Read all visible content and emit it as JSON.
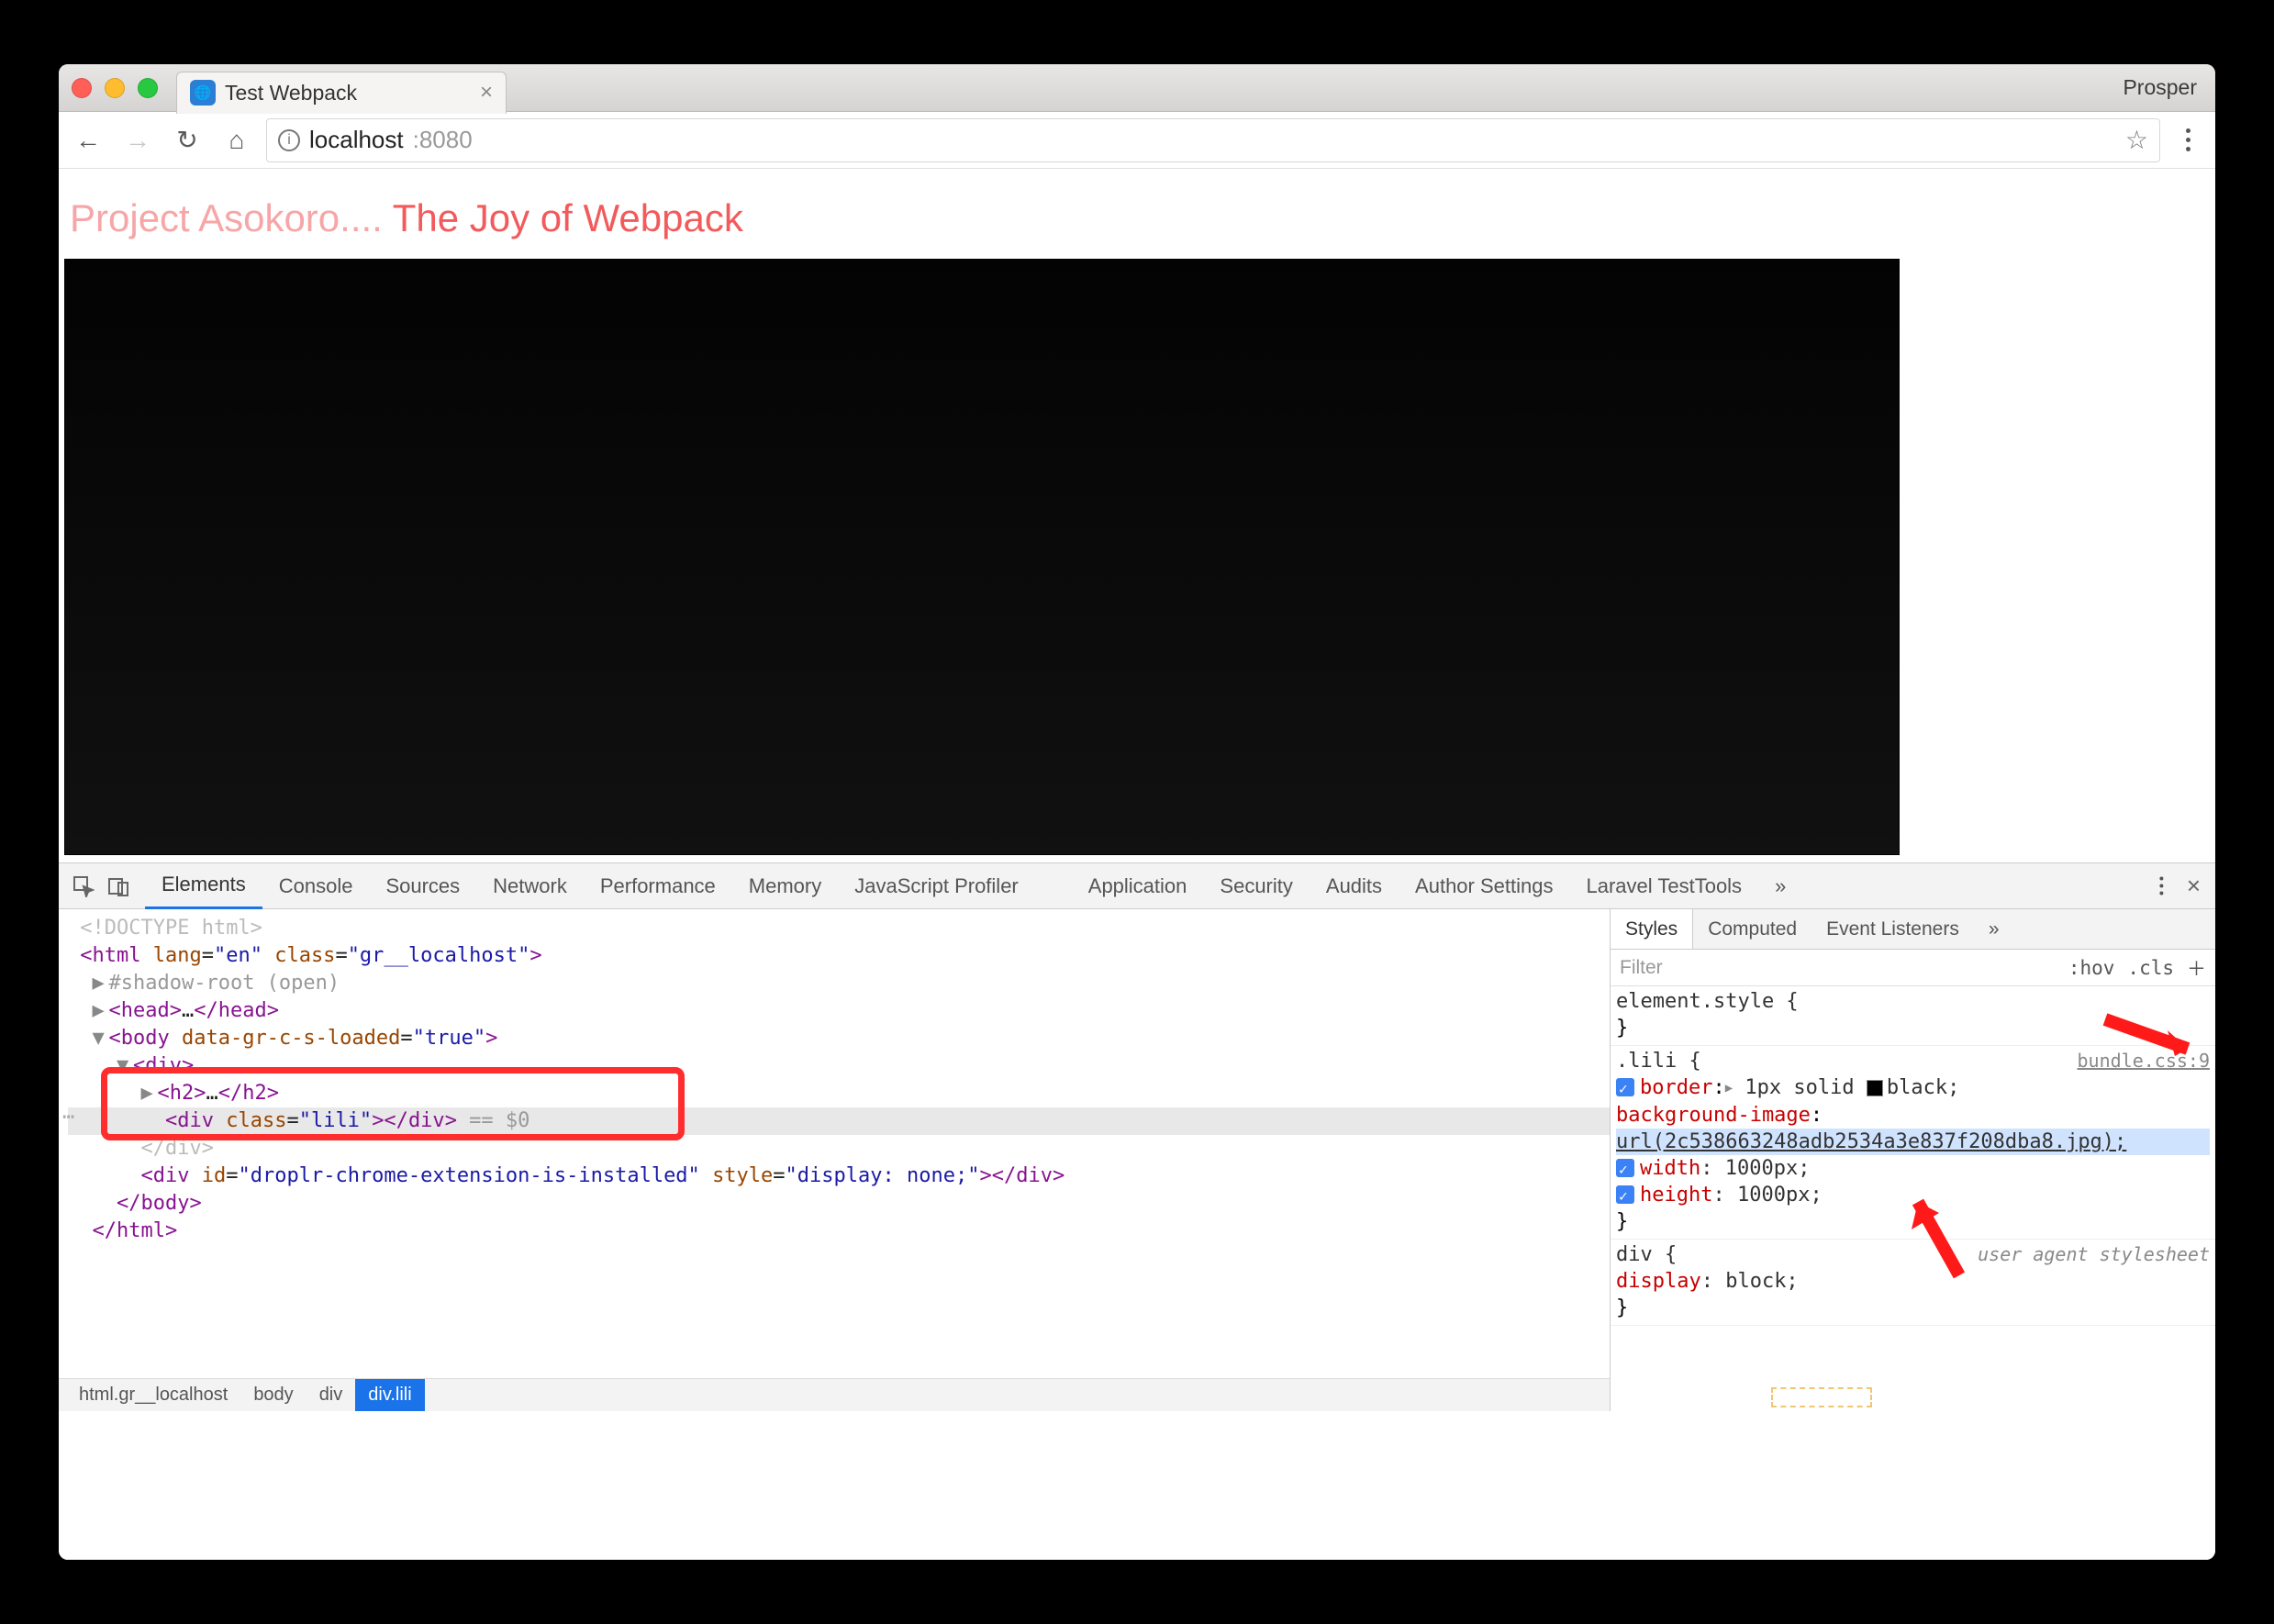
{
  "titlebar": {
    "tab_title": "Test Webpack",
    "profile": "Prosper"
  },
  "urlbar": {
    "host": "localhost",
    "port": ":8080"
  },
  "page": {
    "heading_part1": "Project Asokoro.... ",
    "heading_part2": "The Joy of Webpack"
  },
  "devtools": {
    "tabs": [
      "Elements",
      "Console",
      "Sources",
      "Network",
      "Performance",
      "Memory",
      "JavaScript Profiler",
      "Application",
      "Security",
      "Audits",
      "Author Settings",
      "Laravel TestTools"
    ],
    "active_tab": "Elements",
    "dom": {
      "l0": "<!DOCTYPE html>",
      "l1_open": "<html ",
      "l1_a1n": "lang",
      "l1_a1v": "\"en\"",
      "l1_a2n": "class",
      "l1_a2v": "\"gr__localhost\"",
      "l1_close": ">",
      "l2": "#shadow-root (open)",
      "l3": "<head>…</head>",
      "l4_open": "<body ",
      "l4_a1n": "data-gr-c-s-loaded",
      "l4_a1v": "\"true\"",
      "l4_close": ">",
      "l5": "<div>",
      "l6": "<h2>…</h2>",
      "l7_open": "<div ",
      "l7_a1n": "class",
      "l7_a1v": "\"lili\"",
      "l7_mid": "></div>",
      "l7_sel": " == $0",
      "l8_open": "<div ",
      "l8_a1n": "id",
      "l8_a1v": "\"droplr-chrome-extension-is-installed\"",
      "l8_a2n": "style",
      "l8_a2v": "\"display: none;\"",
      "l8_close": "></div>",
      "l9": "</body>",
      "l10": "</html>"
    },
    "breadcrumbs": [
      "html.gr__localhost",
      "body",
      "div",
      "div.lili"
    ],
    "styles": {
      "tabs": [
        "Styles",
        "Computed",
        "Event Listeners"
      ],
      "filter_placeholder": "Filter",
      "hov": ":hov",
      "cls": ".cls",
      "rule1_sel": "element.style {",
      "rule1_close": "}",
      "rule2_src": "bundle.css:9",
      "rule2_sel": ".lili {",
      "rule2_p1n": "border",
      "rule2_p1v": "1px solid ",
      "rule2_p1c": "black;",
      "rule2_p2n": "background-image",
      "rule2_p2v": ":",
      "rule2_p2url": "url(2c538663248adb2534a3e837f208dba8.jpg);",
      "rule2_p3n": "width",
      "rule2_p3v": ": 1000px;",
      "rule2_p4n": "height",
      "rule2_p4v": ": 1000px;",
      "rule2_close": "}",
      "rule3_src": "user agent stylesheet",
      "rule3_sel": "div {",
      "rule3_p1n": "display",
      "rule3_p1v": ": block;",
      "rule3_close": "}"
    }
  }
}
